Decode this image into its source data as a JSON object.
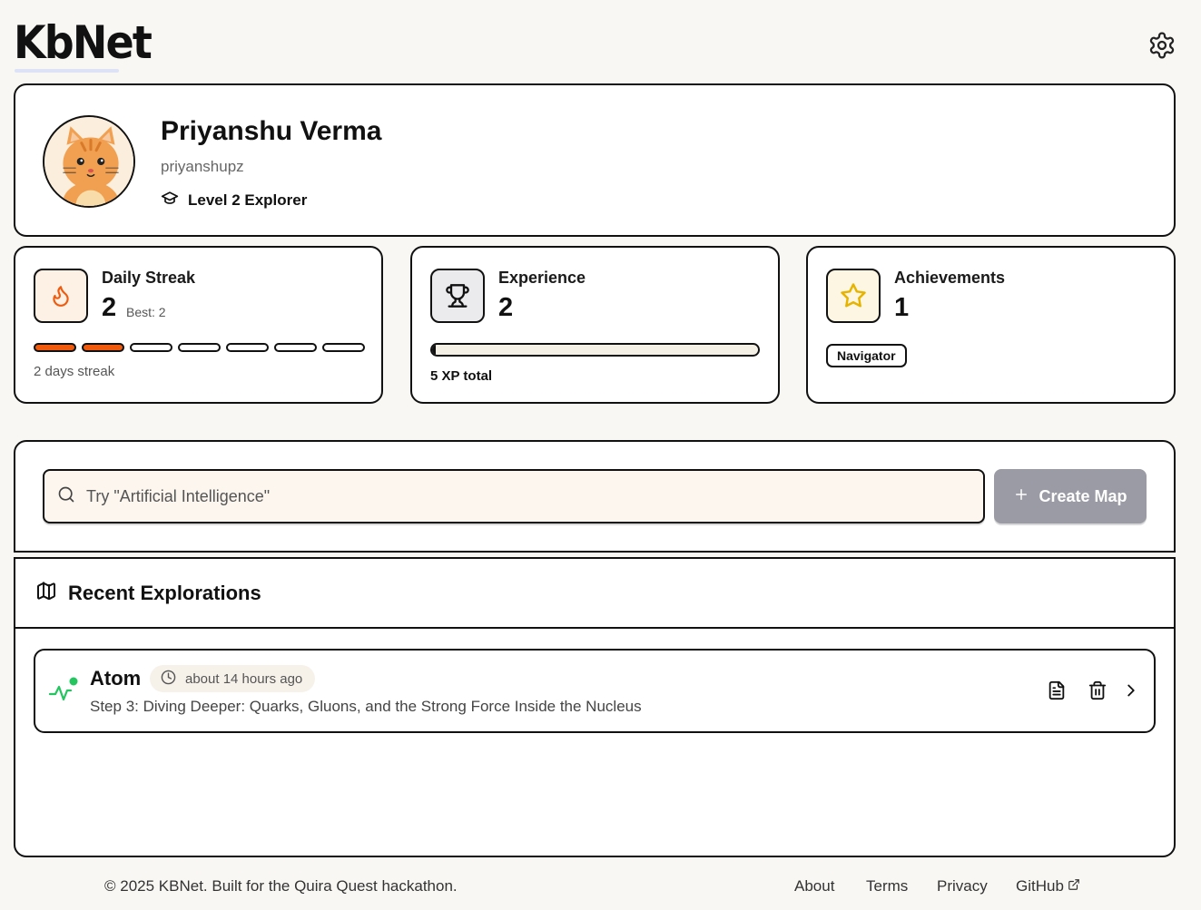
{
  "header": {
    "logo": "KbNet",
    "settings_icon": "gear-icon"
  },
  "profile": {
    "name": "Priyanshu Verma",
    "username": "priyanshupz",
    "level": "Level 2 Explorer",
    "level_icon": "graduation-cap-icon",
    "avatar": "cat-avatar"
  },
  "stats": {
    "streak": {
      "title": "Daily Streak",
      "value": "2",
      "best": "Best: 2",
      "label": "2 days streak",
      "filled_days": 2,
      "total_days": 7,
      "icon": "flame-icon",
      "color": "#f05a0d"
    },
    "experience": {
      "title": "Experience",
      "value": "2",
      "xp_label": "5 XP total",
      "progress_fraction": 0.01,
      "icon": "trophy-icon"
    },
    "achievements": {
      "title": "Achievements",
      "value": "1",
      "badge": "Navigator",
      "icon": "star-icon",
      "color": "#e6b400"
    }
  },
  "search": {
    "placeholder": "Try \"Artificial Intelligence\"",
    "create_button": "Create Map"
  },
  "recent": {
    "title": "Recent Explorations",
    "items": [
      {
        "title": "Atom",
        "time": "about 14 hours ago",
        "description": "Step 3: Diving Deeper: Quarks, Gluons, and the Strong Force Inside the Nucleus",
        "status_color": "#22c55e"
      }
    ]
  },
  "footer": {
    "copyright": "© 2025 KBNet. Built for the Quira Quest hackathon.",
    "links": [
      "About",
      "Terms",
      "Privacy",
      "GitHub"
    ]
  }
}
